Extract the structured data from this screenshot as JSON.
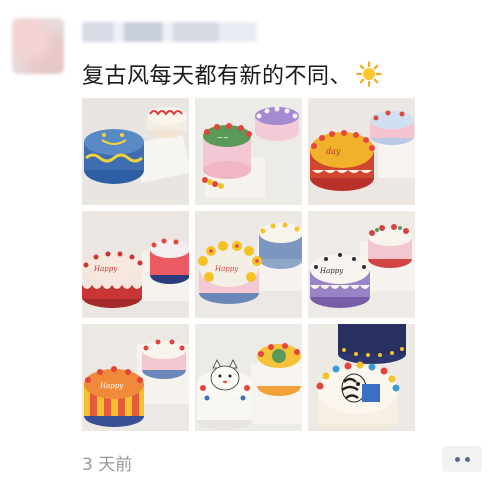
{
  "post": {
    "text": "复古风每天都有新的不同、",
    "emoji_icon": "sun-icon",
    "timestamp": "3 天前",
    "photo_count": 9,
    "photos": [
      {
        "subject": "cake-blue-smiley",
        "accent": "#3f6fb0"
      },
      {
        "subject": "cake-green-purple",
        "accent": "#6da85a"
      },
      {
        "subject": "cake-orange-red",
        "accent": "#e7742a"
      },
      {
        "subject": "cake-red-scalloped",
        "accent": "#c73b32"
      },
      {
        "subject": "cake-yellow-flowers",
        "accent": "#f2c12b"
      },
      {
        "subject": "cake-white-purple",
        "accent": "#8a6fbf"
      },
      {
        "subject": "cake-orange-stripes",
        "accent": "#e98a3a"
      },
      {
        "subject": "cake-kitten-deco",
        "accent": "#e8473f"
      },
      {
        "subject": "cake-zebra-navy",
        "accent": "#27305e"
      }
    ]
  },
  "colors": {
    "text": "#1a1a1a",
    "timestamp": "#9a9a9a",
    "more_dots": "#5b6b8c",
    "more_bg": "#f2f2f4"
  }
}
